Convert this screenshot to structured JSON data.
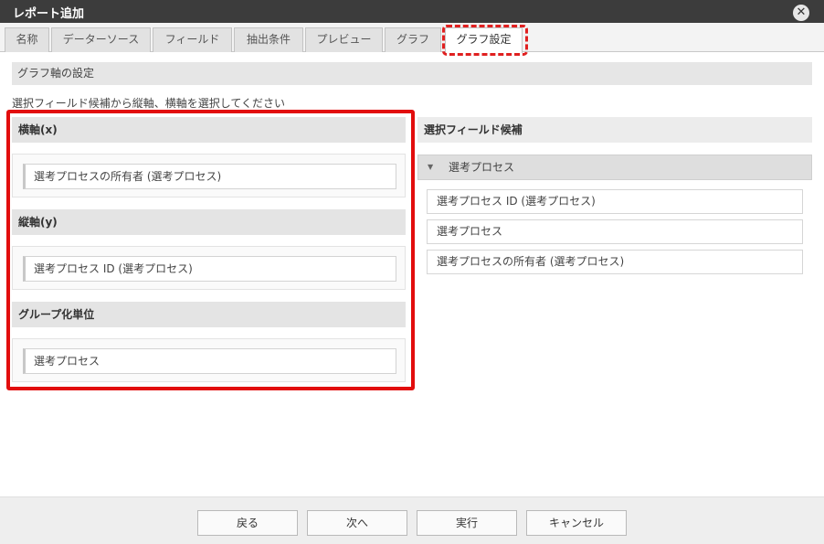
{
  "window": {
    "title": "レポート追加",
    "close_symbol": "✕"
  },
  "tabs": [
    {
      "label": "名称"
    },
    {
      "label": "データーソース"
    },
    {
      "label": "フィールド"
    },
    {
      "label": "抽出条件"
    },
    {
      "label": "プレビュー"
    },
    {
      "label": "グラフ"
    },
    {
      "label": "グラフ設定",
      "active": true
    }
  ],
  "section": {
    "title": "グラフ軸の設定",
    "instruction": "選択フィールド候補から縦軸、横軸を選択してください"
  },
  "axes": {
    "x": {
      "label": "横軸(x)",
      "value": "選考プロセスの所有者 (選考プロセス)"
    },
    "y": {
      "label": "縦軸(y)",
      "value": "選考プロセス ID (選考プロセス)"
    },
    "group": {
      "label": "グループ化単位",
      "value": "選考プロセス"
    }
  },
  "candidates": {
    "title": "選択フィールド候補",
    "category": {
      "label": "選考プロセス",
      "caret": "▼"
    },
    "items": [
      "選考プロセス ID (選考プロセス)",
      "選考プロセス",
      "選考プロセスの所有者 (選考プロセス)"
    ]
  },
  "buttons": {
    "back": "戻る",
    "next": "次へ",
    "run": "実行",
    "cancel": "キャンセル"
  },
  "colors": {
    "highlight": "#e20d0d",
    "titlebar": "#3c3c3c"
  }
}
